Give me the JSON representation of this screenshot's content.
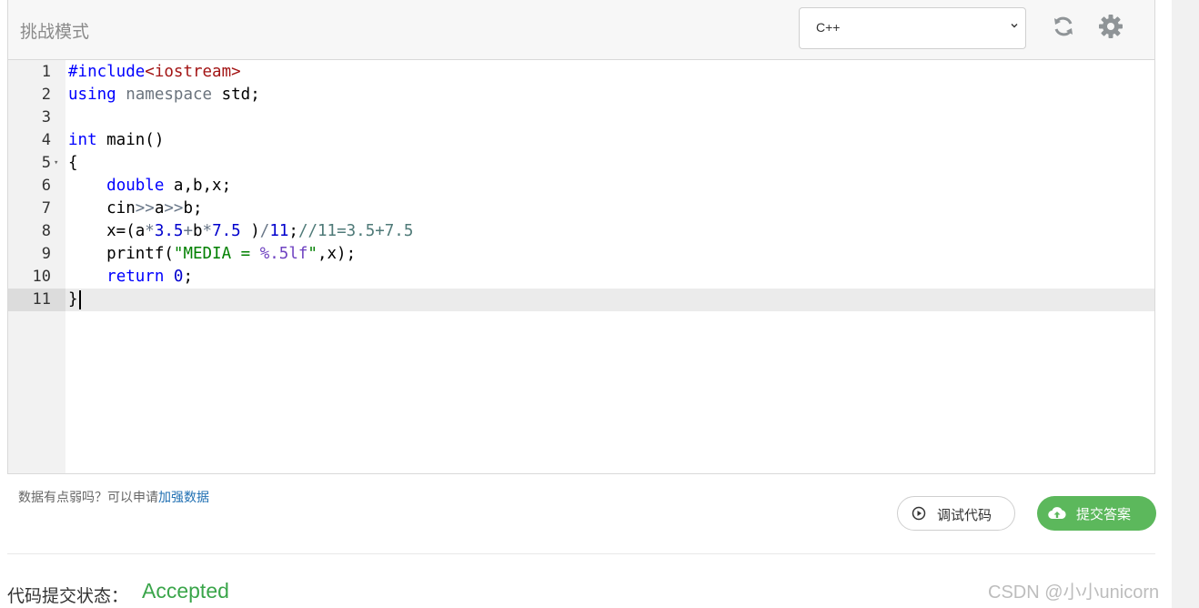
{
  "header": {
    "title": "挑战模式"
  },
  "language_select": {
    "value": "C++"
  },
  "toolbar": {
    "refresh_icon": "refresh-icon",
    "settings_icon": "gear-icon"
  },
  "editor": {
    "lines": [
      {
        "n": "1",
        "tokens": [
          [
            "kw",
            "#include"
          ],
          [
            "inc",
            "<iostream>"
          ]
        ]
      },
      {
        "n": "2",
        "tokens": [
          [
            "kw",
            "using"
          ],
          [
            "plain",
            " "
          ],
          [
            "ns",
            "namespace"
          ],
          [
            "plain",
            " std;"
          ]
        ]
      },
      {
        "n": "3",
        "tokens": []
      },
      {
        "n": "4",
        "tokens": [
          [
            "kw",
            "int"
          ],
          [
            "plain",
            " main()"
          ]
        ]
      },
      {
        "n": "5",
        "tokens": [
          [
            "plain",
            "{"
          ]
        ]
      },
      {
        "n": "6",
        "tokens": [
          [
            "plain",
            "    "
          ],
          [
            "kw",
            "double"
          ],
          [
            "plain",
            " a,b,x;"
          ]
        ]
      },
      {
        "n": "7",
        "tokens": [
          [
            "plain",
            "    cin"
          ],
          [
            "op",
            ">>"
          ],
          [
            "plain",
            "a"
          ],
          [
            "op",
            ">>"
          ],
          [
            "plain",
            "b;"
          ]
        ]
      },
      {
        "n": "8",
        "tokens": [
          [
            "plain",
            "    x=(a"
          ],
          [
            "op",
            "*"
          ],
          [
            "num",
            "3.5"
          ],
          [
            "op",
            "+"
          ],
          [
            "plain",
            "b"
          ],
          [
            "op",
            "*"
          ],
          [
            "num",
            "7.5"
          ],
          [
            "plain",
            " )"
          ],
          [
            "op",
            "/"
          ],
          [
            "num",
            "11"
          ],
          [
            "plain",
            ";"
          ],
          [
            "cmt",
            "//11=3.5+7.5"
          ]
        ]
      },
      {
        "n": "9",
        "tokens": [
          [
            "plain",
            "    printf("
          ],
          [
            "str",
            "\"MEDIA = "
          ],
          [
            "fmt",
            "%.5lf"
          ],
          [
            "str",
            "\""
          ],
          [
            "plain",
            ",x);"
          ]
        ]
      },
      {
        "n": "10",
        "tokens": [
          [
            "plain",
            "    "
          ],
          [
            "kw",
            "return"
          ],
          [
            "plain",
            " "
          ],
          [
            "num",
            "0"
          ],
          [
            "plain",
            ";"
          ]
        ]
      },
      {
        "n": "11",
        "tokens": [
          [
            "plain",
            "}"
          ]
        ]
      }
    ]
  },
  "hint": {
    "text": "数据有点弱吗？可以申请",
    "link": "加强数据"
  },
  "buttons": {
    "debug": "调试代码",
    "submit": "提交答案"
  },
  "status": {
    "label": "代码提交状态：",
    "value": "Accepted"
  },
  "watermark": "CSDN @小小unicorn"
}
